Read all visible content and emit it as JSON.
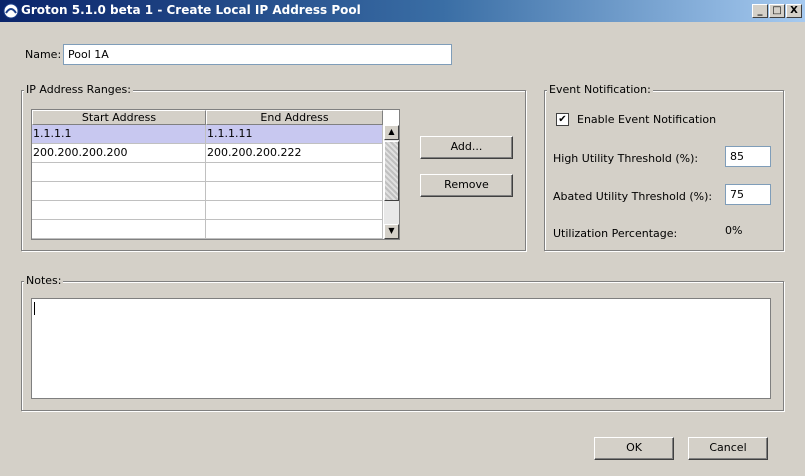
{
  "window": {
    "title": "Groton 5.1.0 beta 1 - Create Local IP Address Pool",
    "controls": {
      "minimize": "_",
      "maximize": "□",
      "close": "X"
    }
  },
  "name": {
    "label": "Name:",
    "value": "Pool 1A"
  },
  "ip_ranges": {
    "title": "IP Address Ranges:",
    "headers": [
      "Start Address",
      "End Address"
    ],
    "rows": [
      [
        "1.1.1.1",
        "1.1.1.11"
      ],
      [
        "200.200.200.200",
        "200.200.200.222"
      ],
      [
        "",
        ""
      ],
      [
        "",
        ""
      ],
      [
        "",
        ""
      ],
      [
        "",
        ""
      ]
    ],
    "add_label": "Add...",
    "remove_label": "Remove"
  },
  "event_notification": {
    "title": "Event Notification:",
    "enable_label": "Enable Event Notification",
    "enable_checked": true,
    "high_label": "High Utility Threshold (%):",
    "high_value": "85",
    "abated_label": "Abated Utility Threshold (%):",
    "abated_value": "75",
    "util_label": "Utilization Percentage:",
    "util_value": "0%"
  },
  "notes": {
    "title": "Notes:",
    "value": ""
  },
  "footer": {
    "ok_label": "OK",
    "cancel_label": "Cancel"
  }
}
